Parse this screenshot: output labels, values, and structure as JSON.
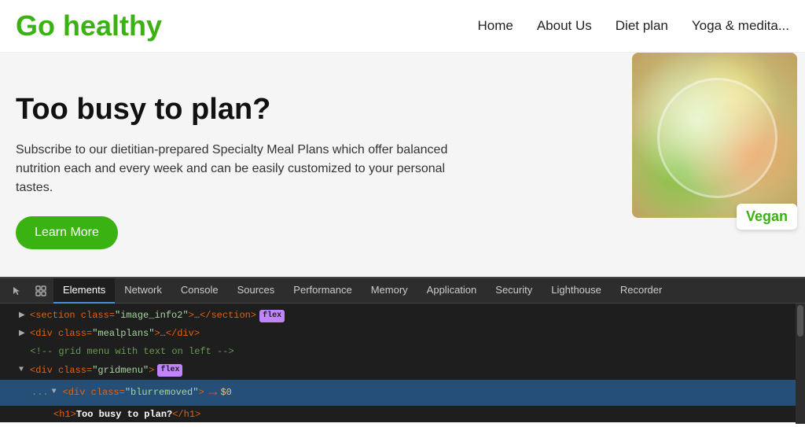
{
  "header": {
    "logo": "Go healthy",
    "nav": {
      "items": [
        "Home",
        "About Us",
        "Diet plan",
        "Yoga & medita..."
      ]
    }
  },
  "hero": {
    "title": "Too busy to plan?",
    "description": "Subscribe to our dietitian-prepared Specialty Meal Plans which offer balanced nutrition each and every week and can be easily customized to your personal tastes.",
    "button_label": "Learn More",
    "vegan_badge": "Vegan"
  },
  "devtools": {
    "tabs": [
      "Elements",
      "Network",
      "Console",
      "Sources",
      "Performance",
      "Memory",
      "Application",
      "Security",
      "Lighthouse",
      "Recorder"
    ],
    "active_tab": "Elements",
    "lines": [
      {
        "indent": 1,
        "arrow": "collapsed",
        "html": "<section class=\"image_info2\">…</section>",
        "flex": true
      },
      {
        "indent": 1,
        "arrow": "collapsed",
        "html": "<div class=\"mealplans\">…</div>",
        "flex": false
      },
      {
        "indent": 1,
        "comment": "<!-- grid menu with text on left -->"
      },
      {
        "indent": 1,
        "arrow": "expanded",
        "html": "<div class=\"gridmenu\">",
        "flex": true
      },
      {
        "indent": 2,
        "arrow": "expanded",
        "html": "<div class=\"blurremoved\">",
        "flex": false,
        "selected": true
      },
      {
        "indent": 3,
        "arrow": "none",
        "html": "<h1> Too busy to plan?</h1>"
      }
    ]
  }
}
